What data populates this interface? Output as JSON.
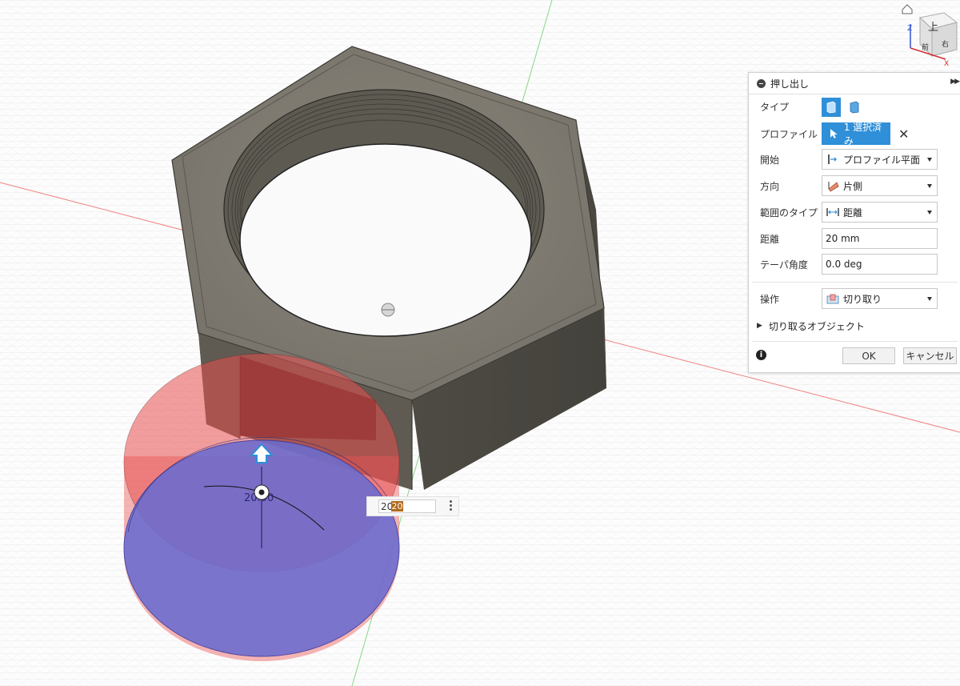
{
  "viewcube": {
    "top_label": "上",
    "front_label": "前",
    "right_label": "右"
  },
  "dialog": {
    "title": "押し出し",
    "rows": {
      "type": {
        "label": "タイプ"
      },
      "profile": {
        "label": "プロファイル",
        "selection": "1 選択済み"
      },
      "start": {
        "label": "開始",
        "value": "プロファイル平面"
      },
      "direction": {
        "label": "方向",
        "value": "片側"
      },
      "extent_type": {
        "label": "範囲のタイプ",
        "value": "距離"
      },
      "distance": {
        "label": "距離",
        "value": "20 mm"
      },
      "taper": {
        "label": "テーパ角度",
        "value": "0.0 deg"
      },
      "operation": {
        "label": "操作",
        "value": "切り取り"
      }
    },
    "objects_to_cut": "切り取るオブジェクト",
    "ok_label": "OK",
    "cancel_label": "キャンセル"
  },
  "hud": {
    "value": "20",
    "label": "20.00"
  },
  "colors": {
    "accent": "#2f8fd8",
    "profile_fill": "#6a6bd0",
    "cut_fill": "#e05050",
    "part": "#7f7b6f"
  }
}
